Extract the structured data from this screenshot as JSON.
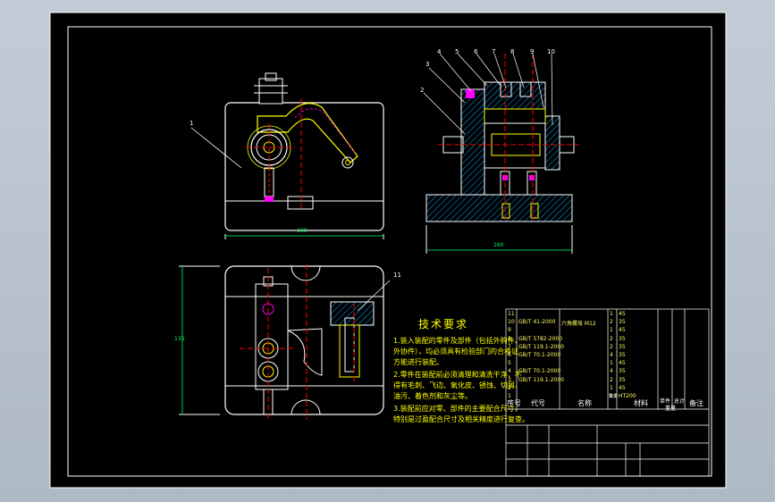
{
  "balloons": [
    "1",
    "2",
    "3",
    "4",
    "5",
    "6",
    "7",
    "8",
    "9",
    "10",
    "11"
  ],
  "dimensions": {
    "front_width": "180",
    "side_width": "160",
    "plan_height": "135"
  },
  "tech": {
    "title": "技术要求",
    "lines": [
      "1.装入装配的零件及部件（包括外购件、",
      "外协件），均必须具有检验部门的合格证",
      "方能进行装配。",
      "2.零件在装配前必须清理和清洗干净，不",
      "得有毛刺、飞边、氧化皮、锈蚀、切屑、",
      "油污、着色剂和灰尘等。",
      "3.装配前应对零、部件的主要配合尺寸，",
      "特别是过盈配合尺寸及相关精度进行复查。"
    ]
  },
  "bom": {
    "rows": [
      {
        "no": "11",
        "code": "",
        "name": "",
        "qty": "1",
        "mat": "45"
      },
      {
        "no": "10",
        "code": "GB/T 41-2000",
        "name": "六角螺母 M12",
        "qty": "2",
        "mat": "35"
      },
      {
        "no": "9",
        "code": "",
        "name": "",
        "qty": "1",
        "mat": "45"
      },
      {
        "no": "8",
        "code": "GB/T 5782-2000",
        "name": "",
        "qty": "2",
        "mat": "35"
      },
      {
        "no": "7",
        "code": "GB/T 119.1-2000",
        "name": "",
        "qty": "2",
        "mat": "35"
      },
      {
        "no": "6",
        "code": "GB/T 70.1-2000",
        "name": "",
        "qty": "4",
        "mat": "35"
      },
      {
        "no": "5",
        "code": "",
        "name": "",
        "qty": "1",
        "mat": "45"
      },
      {
        "no": "4",
        "code": "GB/T 70.1-2000",
        "name": "",
        "qty": "4",
        "mat": "35"
      },
      {
        "no": "3",
        "code": "GB/T 119.1-2000",
        "name": "",
        "qty": "2",
        "mat": "35"
      },
      {
        "no": "2",
        "code": "",
        "name": "",
        "qty": "1",
        "mat": "45"
      },
      {
        "no": "1",
        "code": "",
        "name": "",
        "qty": "1",
        "mat": "HT200"
      }
    ],
    "header": {
      "no": "序号",
      "code": "代号",
      "name": "名称",
      "qty": "数量",
      "mat": "材料",
      "unit": "单件",
      "total": "总计",
      "weight": "重量",
      "note": "备注"
    }
  }
}
